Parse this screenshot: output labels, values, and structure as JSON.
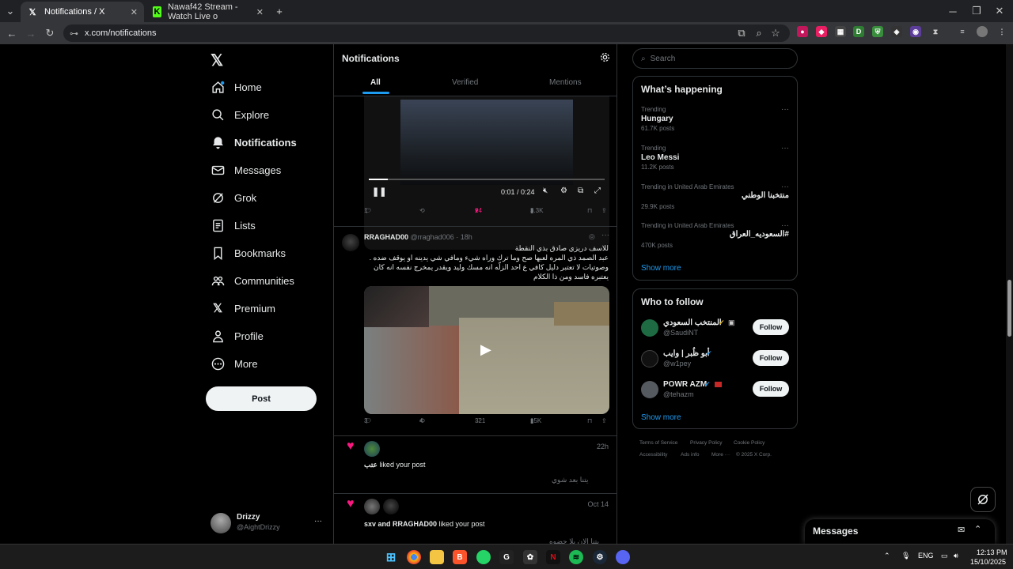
{
  "browser": {
    "tabs": [
      {
        "title": "Notifications / X",
        "favicon": "X"
      },
      {
        "title": "Nawaf42 Stream - Watch Live o",
        "favicon": "K"
      }
    ],
    "new_tab_label": "+",
    "url": "x.com/notifications"
  },
  "nav": {
    "items": [
      {
        "label": "Home",
        "icon": "home-icon"
      },
      {
        "label": "Explore",
        "icon": "search-icon"
      },
      {
        "label": "Notifications",
        "icon": "bell-icon"
      },
      {
        "label": "Messages",
        "icon": "envelope-icon"
      },
      {
        "label": "Grok",
        "icon": "grok-icon"
      },
      {
        "label": "Lists",
        "icon": "list-icon"
      },
      {
        "label": "Bookmarks",
        "icon": "bookmark-icon"
      },
      {
        "label": "Communities",
        "icon": "people-icon"
      },
      {
        "label": "Premium",
        "icon": "x-icon"
      },
      {
        "label": "Profile",
        "icon": "person-icon"
      },
      {
        "label": "More",
        "icon": "more-circle-icon"
      }
    ],
    "post_label": "Post",
    "account": {
      "name": "Drizzy",
      "handle": "@AightDrizzy",
      "menu": "···"
    }
  },
  "notifications": {
    "title": "Notifications",
    "tabs": [
      "All",
      "Verified",
      "Mentions"
    ],
    "video1": {
      "time": "0:01 / 0:24"
    },
    "tweet1_actions": {
      "replies": "1",
      "retweets": "",
      "likes": "24",
      "views": "3.3K"
    },
    "tweet2": {
      "name": "RRAGHAD00",
      "handle": "@rraghad006",
      "time": "· 18h",
      "lines": [
        "للاسف دريزي صادق بذي النقطة",
        "عبد الصمد ذي المره لعبها صح وما ترك وراه شيء ومافي شي يدينه او يوقف ضده .",
        "وصوتيات لا تعتبر دليل كافي ع احد الزلّه انه مسك وليد ويقدر يمخرج نفسه انه كان",
        "يعتبره فاسد ومن ذا الكلام"
      ],
      "actions": {
        "replies": "3",
        "retweets": "4",
        "likes": "321",
        "views": "15K"
      }
    },
    "like1": {
      "time": "22h",
      "text_name": "عتب",
      "text": " liked your post",
      "quote": "يتنا بعد شوي"
    },
    "like2": {
      "time": "Oct 14",
      "text_name": "sxv and RRAGHAD00",
      "text": " liked your post",
      "quote": "يتنا الان بلا جضوه"
    }
  },
  "search": {
    "placeholder": "Search"
  },
  "happening": {
    "title": "What’s happening",
    "trends": [
      {
        "meta": "Trending",
        "name": "Hungary",
        "posts": "61.7K posts"
      },
      {
        "meta": "Trending",
        "name": "Leo Messi",
        "posts": "11.2K posts"
      },
      {
        "meta": "Trending in United Arab Emirates",
        "name": "منتخبنا الوطني",
        "posts": "29.9K posts"
      },
      {
        "meta": "Trending in United Arab Emirates",
        "name": "#السعوديه_العراق",
        "posts": "470K posts"
      }
    ],
    "show_more": "Show more"
  },
  "who_to_follow": {
    "title": "Who to follow",
    "accounts": [
      {
        "name": "المنتخب السعودي",
        "handle": "@SaudiNT",
        "button": "Follow",
        "color": "#1e6b43"
      },
      {
        "name": "أبو ظُبر | وايب",
        "handle": "@w1pey",
        "button": "Follow",
        "color": "#111111"
      },
      {
        "name": "POWR AZM",
        "handle": "@tehazm",
        "button": "Follow",
        "color": "#555a60"
      }
    ],
    "show_more": "Show more"
  },
  "footer": {
    "links": [
      "Terms of Service",
      "Privacy Policy",
      "Cookie Policy",
      "Accessibility",
      "Ads info",
      "More ···",
      "© 2025 X Corp."
    ]
  },
  "messages_dock": {
    "title": "Messages"
  },
  "taskbar": {
    "lang": "ENG",
    "time": "12:13 PM",
    "date": "15/10/2025"
  },
  "colors": {
    "accent": "#1d9bf0",
    "like": "#f91880"
  }
}
